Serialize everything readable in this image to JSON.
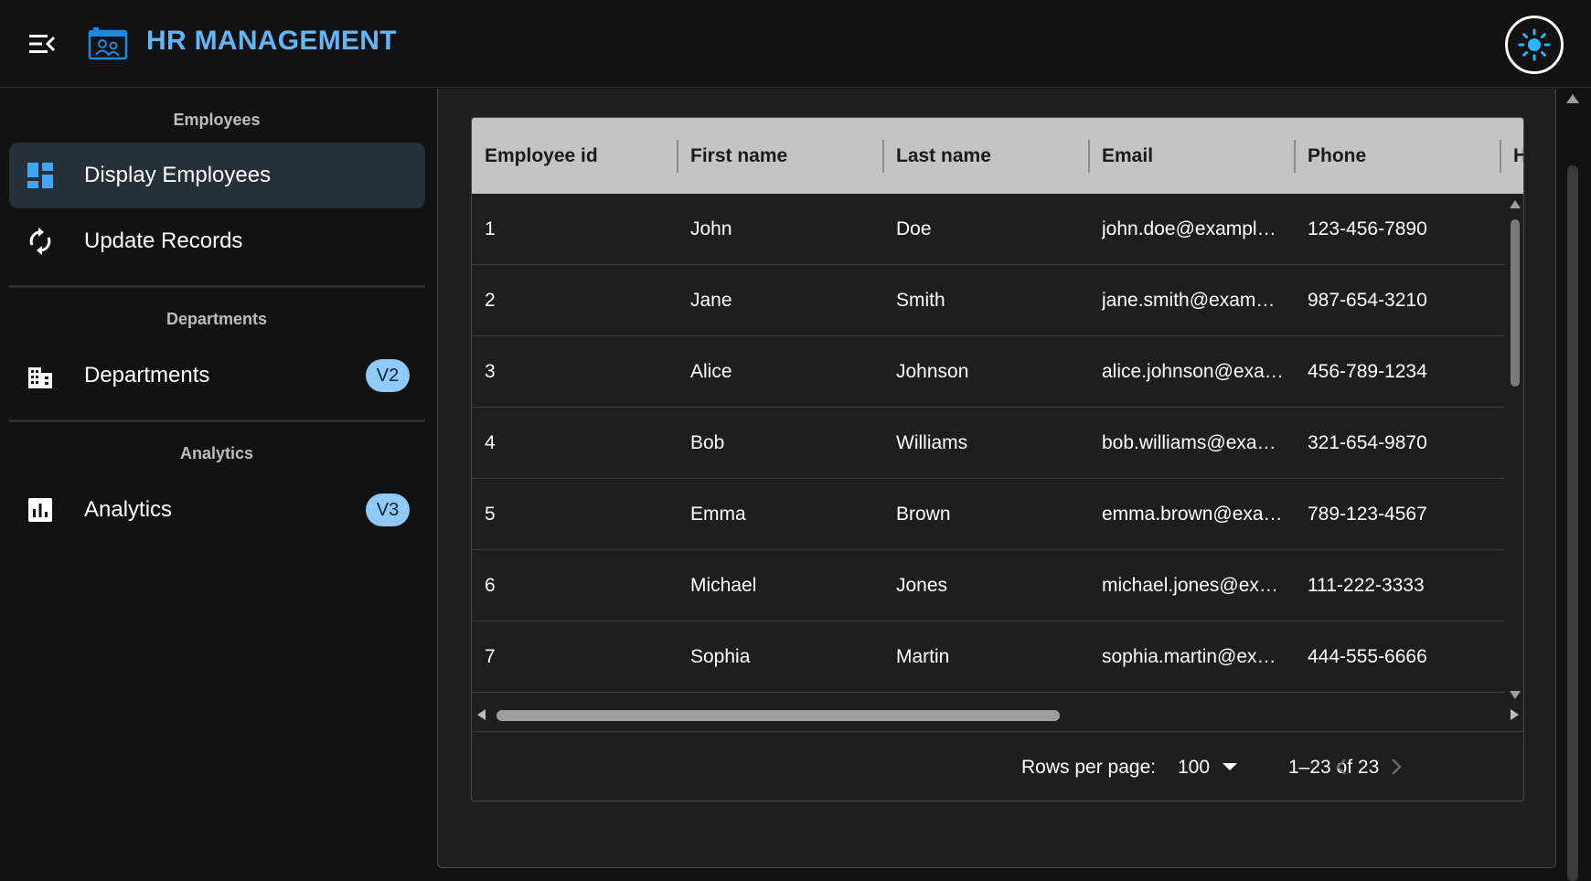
{
  "header": {
    "title": "HR MANAGEMENT",
    "menu_icon": "menu-collapse-icon",
    "logo_icon": "employee-badge-icon",
    "theme_icon": "sun-icon"
  },
  "sidebar": {
    "sections": [
      {
        "title": "Employees",
        "items": [
          {
            "label": "Display Employees",
            "icon": "dashboard-icon",
            "active": true
          },
          {
            "label": "Update Records",
            "icon": "sync-icon",
            "active": false
          }
        ]
      },
      {
        "title": "Departments",
        "items": [
          {
            "label": "Departments",
            "icon": "building-icon",
            "badge": "V2"
          }
        ]
      },
      {
        "title": "Analytics",
        "items": [
          {
            "label": "Analytics",
            "icon": "bar-chart-icon",
            "badge": "V3"
          }
        ]
      }
    ]
  },
  "table": {
    "columns": [
      "Employee id",
      "First name",
      "Last name",
      "Email",
      "Phone",
      "H"
    ],
    "rows": [
      [
        "1",
        "John",
        "Doe",
        "john.doe@exampl…",
        "123-456-7890"
      ],
      [
        "2",
        "Jane",
        "Smith",
        "jane.smith@exam…",
        "987-654-3210"
      ],
      [
        "3",
        "Alice",
        "Johnson",
        "alice.johnson@exa…",
        "456-789-1234"
      ],
      [
        "4",
        "Bob",
        "Williams",
        "bob.williams@exa…",
        "321-654-9870"
      ],
      [
        "5",
        "Emma",
        "Brown",
        "emma.brown@exa…",
        "789-123-4567"
      ],
      [
        "6",
        "Michael",
        "Jones",
        "michael.jones@ex…",
        "111-222-3333"
      ],
      [
        "7",
        "Sophia",
        "Martin",
        "sophia.martin@ex…",
        "444-555-6666"
      ]
    ],
    "footer": {
      "rows_per_page_label": "Rows per page:",
      "rows_per_page_value": "100",
      "range": "1–23 of 23"
    }
  },
  "colors": {
    "accent": "#64b5f6",
    "badge_bg": "#90caf9",
    "active_bg": "#26303b",
    "header_bg": "#c4c4c4"
  }
}
